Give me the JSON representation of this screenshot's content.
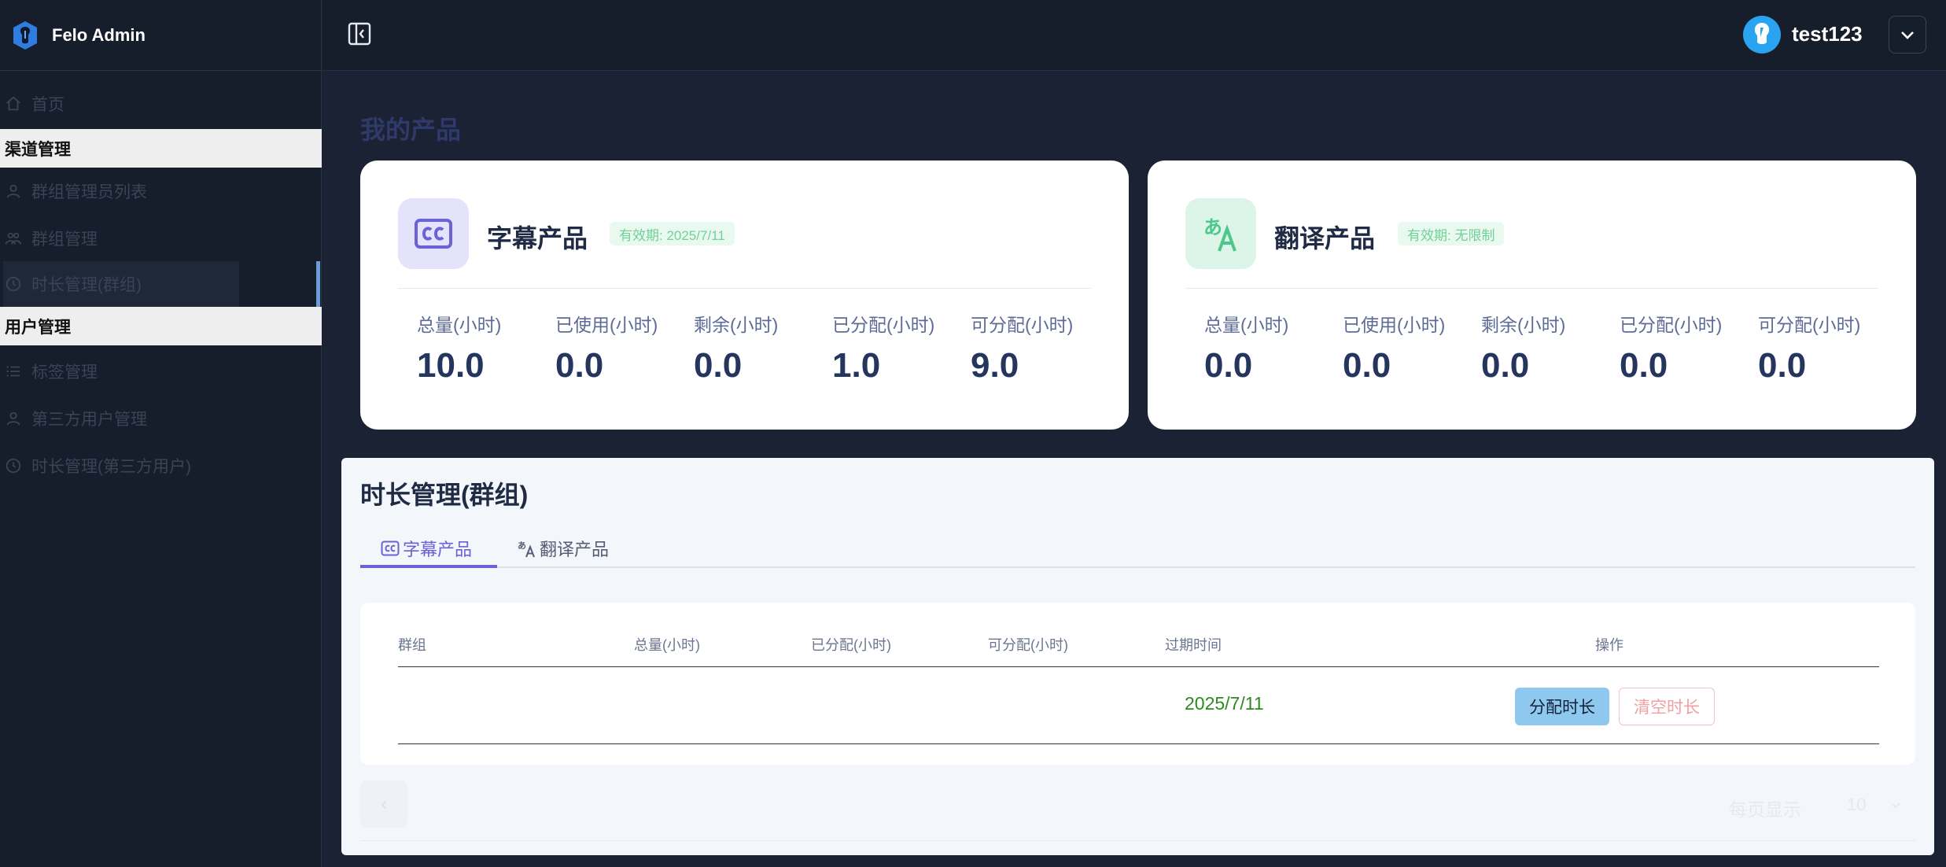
{
  "app": {
    "brand": "Felo Admin"
  },
  "sidebar": {
    "items": [
      {
        "label": "首页",
        "icon": "home-icon"
      },
      {
        "label": "渠道管理",
        "section": true
      },
      {
        "label": "群组管理员列表",
        "icon": "user-icon"
      },
      {
        "label": "群组管理",
        "icon": "group-icon"
      },
      {
        "label": "时长管理(群组)",
        "icon": "clock-icon",
        "active": true
      },
      {
        "label": "用户管理",
        "section": true
      },
      {
        "label": "标签管理",
        "icon": "list-icon"
      },
      {
        "label": "第三方用户管理",
        "icon": "user-icon"
      },
      {
        "label": "时长管理(第三方用户)",
        "icon": "clock-icon"
      }
    ]
  },
  "header": {
    "username": "test123"
  },
  "main": {
    "title": "我的产品",
    "products": [
      {
        "name": "字幕产品",
        "validity": "有效期: 2025/7/11",
        "icon": "cc-icon",
        "accent": "#6a63d6",
        "stats": [
          {
            "label": "总量(小时)",
            "value": "10.0"
          },
          {
            "label": "已使用(小时)",
            "value": "0.0"
          },
          {
            "label": "剩余(小时)",
            "value": "0.0"
          },
          {
            "label": "已分配(小时)",
            "value": "1.0"
          },
          {
            "label": "可分配(小时)",
            "value": "9.0"
          }
        ]
      },
      {
        "name": "翻译产品",
        "validity": "有效期: 无限制",
        "icon": "translate-icon",
        "accent": "#4cc98a",
        "stats": [
          {
            "label": "总量(小时)",
            "value": "0.0"
          },
          {
            "label": "已使用(小时)",
            "value": "0.0"
          },
          {
            "label": "剩余(小时)",
            "value": "0.0"
          },
          {
            "label": "已分配(小时)",
            "value": "0.0"
          },
          {
            "label": "可分配(小时)",
            "value": "0.0"
          }
        ]
      }
    ]
  },
  "panel": {
    "title": "时长管理(群组)",
    "tabs": [
      {
        "label": "字幕产品",
        "active": true
      },
      {
        "label": "翻译产品",
        "active": false
      }
    ],
    "table": {
      "columns": [
        "群组",
        "总量(小时)",
        "已分配(小时)",
        "可分配(小时)",
        "过期时间",
        "操作"
      ],
      "rows": [
        {
          "group": "",
          "total": "",
          "assigned": "",
          "available": "",
          "expire": "2025/7/11",
          "actions": [
            "分配时长",
            "清空时长"
          ]
        }
      ]
    },
    "pagination": {
      "prev": "‹",
      "per_page_label": "每页显示",
      "per_page": "10"
    }
  }
}
